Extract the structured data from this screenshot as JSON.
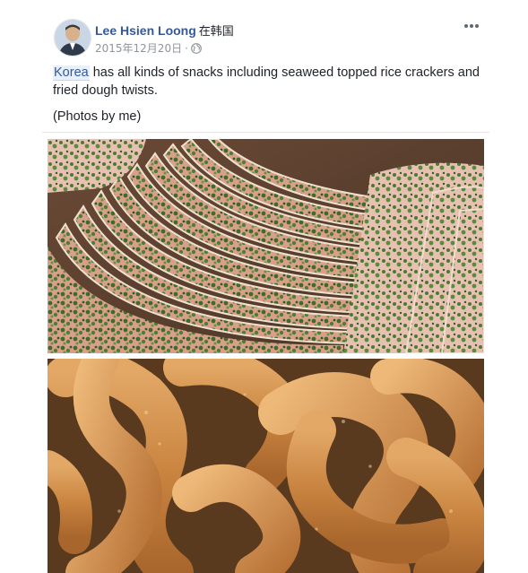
{
  "post": {
    "author": "Lee Hsien Loong",
    "location": "在韩国",
    "date": "2015年12月20日",
    "separator": "·",
    "privacy_icon": "globe-icon",
    "more_icon": "more-options-icon",
    "text": {
      "tagged": "Korea",
      "body": " has all kinds of snacks including seaweed topped rice crackers and fried dough twists.",
      "credit": "(Photos by me)"
    },
    "photos": [
      "seaweed-rice-crackers-photo",
      "fried-dough-twists-photo"
    ]
  },
  "colors": {
    "link": "#365899",
    "meta": "#90949c",
    "text": "#1d2129"
  }
}
